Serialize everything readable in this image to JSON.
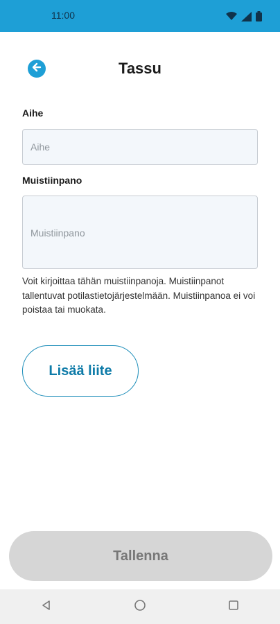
{
  "status_bar": {
    "time": "11:00",
    "icons": [
      "wifi-icon",
      "signal-icon",
      "battery-icon"
    ],
    "background": "#1e9fd6"
  },
  "header": {
    "title": "Tassu",
    "back_icon": "arrow-left-circle-icon"
  },
  "form": {
    "subject": {
      "label": "Aihe",
      "placeholder": "Aihe",
      "value": ""
    },
    "note": {
      "label": "Muistiinpano",
      "placeholder": "Muistiinpano",
      "value": ""
    },
    "help_text": "Voit kirjoittaa tähän muistiinpanoja. Muistiinpanot tallentuvat potilastietojärjestelmään. Muistiinpanoa ei voi poistaa tai muokata."
  },
  "attach_button": {
    "label": "Lisää liite"
  },
  "save_button": {
    "label": "Tallenna",
    "enabled": false
  },
  "nav_bar": {
    "icons": [
      "back-triangle-icon",
      "home-circle-icon",
      "recents-square-icon"
    ]
  },
  "colors": {
    "accent": "#1e9fd6",
    "attach_text": "#0e7ba8",
    "save_disabled_bg": "#d6d6d6"
  }
}
